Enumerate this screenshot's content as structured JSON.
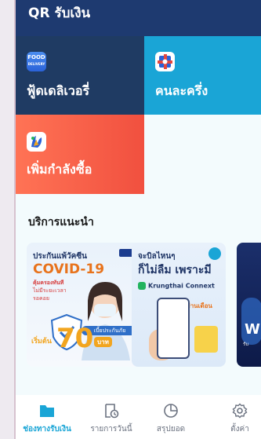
{
  "top_strip": {
    "label": "QR รับเงิน"
  },
  "tiles": {
    "food": {
      "label": "ฟู้ดเดลิเวอรี่",
      "icon": "food-delivery-icon",
      "icon_text": "FOOD",
      "icon_subtext": "DELIVERY",
      "color": "#1f3b63"
    },
    "half_half": {
      "label": "คนละครึ่ง",
      "icon": "half-half-icon",
      "color": "#1aa5d6"
    },
    "boost": {
      "label": "เพิ่มกำลังซื้อ",
      "icon": "boost-icon",
      "color": "#f1503f"
    }
  },
  "section": {
    "title": "บริการแนะนำ"
  },
  "cards": [
    {
      "line1": "ประกันแพ้วัคซีน",
      "line2": "COVID-19",
      "line3": "คุ้มครองทันที",
      "line4": "ไม่มีระยะเวลา",
      "line5": "รอคอย",
      "cover_tag": "เบี้ยประกันภัย",
      "start": "เริ่มต้น",
      "price": "70",
      "unit": "บาท"
    },
    {
      "line1": "จะบิลไหนๆ",
      "line2": "ก็ไม่ลืม เพราะมี",
      "brand": "Krungthai Connext",
      "tag": "ผ่านเดือน"
    },
    {
      "title": "W",
      "subtitle": "รับ"
    }
  ],
  "bottom_nav": [
    {
      "label": "ช่องทางรับเงิน",
      "icon": "folder-icon",
      "active": true
    },
    {
      "label": "รายการวันนี้",
      "icon": "receipt-clock-icon",
      "active": false
    },
    {
      "label": "สรุปยอด",
      "icon": "pie-chart-icon",
      "active": false
    },
    {
      "label": "ตั้งค่า",
      "icon": "gear-icon",
      "active": false
    }
  ],
  "colors": {
    "accent": "#1aa5d6",
    "navy": "#1e3a70",
    "inactive": "#6b7280"
  }
}
